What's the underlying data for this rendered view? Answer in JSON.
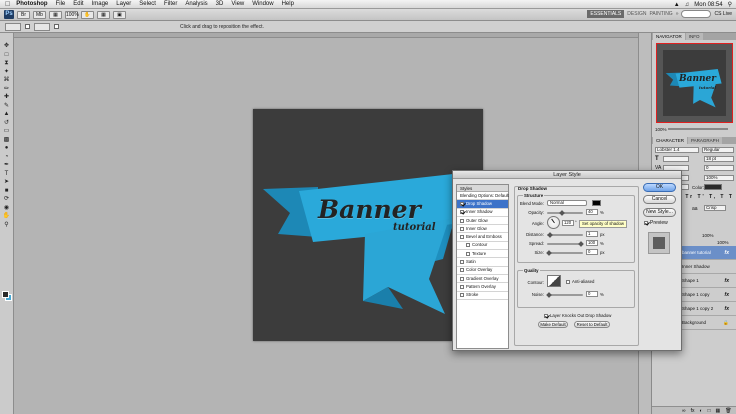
{
  "menubar": {
    "app": "Photoshop",
    "items": [
      "File",
      "Edit",
      "Image",
      "Layer",
      "Select",
      "Filter",
      "Analysis",
      "3D",
      "View",
      "Window",
      "Help"
    ],
    "clock": "Mon 08:54"
  },
  "appbar": {
    "zoom": "100%",
    "workspaces": [
      "ESSENTIALS",
      "DESIGN",
      "PAINTING"
    ],
    "cs_live": "CS Live"
  },
  "options": {
    "hint": "Click and drag to reposition the effect."
  },
  "canvas": {
    "title": "Banner",
    "subtitle": "tutorial",
    "ribbon_color": "#29a8d8"
  },
  "navigator": {
    "tabs": [
      "NAVIGATOR",
      "INFO"
    ],
    "zoom": "100%",
    "title": "Banner",
    "subtitle": "tutorial"
  },
  "character": {
    "tabs": [
      "CHARACTER",
      "PARAGRAPH"
    ],
    "font": "Lobster 1.4",
    "style": "Regular",
    "size": "18 pt",
    "leading": "0",
    "scale": "100%",
    "color_label": "Color:",
    "aa": "Crisp"
  },
  "layers": {
    "rows": [
      {
        "name": "banner tutorial",
        "fx": "fx",
        "selected": true
      },
      {
        "name": "Inner Shadow",
        "fx": "",
        "selected": false
      },
      {
        "name": "Shape 1",
        "fx": "fx",
        "selected": false
      },
      {
        "name": "Shape 1 copy",
        "fx": "fx",
        "selected": false
      },
      {
        "name": "Shape 1 copy 2",
        "fx": "fx",
        "selected": false
      },
      {
        "name": "Background",
        "fx": "",
        "selected": false
      }
    ],
    "opacity": "100%",
    "fill": "100%"
  },
  "dialog": {
    "title": "Layer Style",
    "styles_header": "Styles",
    "styles": [
      {
        "label": "Blending Options: Default",
        "check": false,
        "hasbox": false,
        "indent": false,
        "selected": false
      },
      {
        "label": "Drop Shadow",
        "check": true,
        "hasbox": true,
        "indent": false,
        "selected": true
      },
      {
        "label": "Inner Shadow",
        "check": true,
        "hasbox": true,
        "indent": false,
        "selected": false
      },
      {
        "label": "Outer Glow",
        "check": false,
        "hasbox": true,
        "indent": false,
        "selected": false
      },
      {
        "label": "Inner Glow",
        "check": false,
        "hasbox": true,
        "indent": false,
        "selected": false
      },
      {
        "label": "Bevel and Emboss",
        "check": false,
        "hasbox": true,
        "indent": false,
        "selected": false
      },
      {
        "label": "Contour",
        "check": false,
        "hasbox": true,
        "indent": true,
        "selected": false
      },
      {
        "label": "Texture",
        "check": false,
        "hasbox": true,
        "indent": true,
        "selected": false
      },
      {
        "label": "Satin",
        "check": false,
        "hasbox": true,
        "indent": false,
        "selected": false
      },
      {
        "label": "Color Overlay",
        "check": false,
        "hasbox": true,
        "indent": false,
        "selected": false
      },
      {
        "label": "Gradient Overlay",
        "check": false,
        "hasbox": true,
        "indent": false,
        "selected": false
      },
      {
        "label": "Pattern Overlay",
        "check": false,
        "hasbox": true,
        "indent": false,
        "selected": false
      },
      {
        "label": "Stroke",
        "check": false,
        "hasbox": true,
        "indent": false,
        "selected": false
      }
    ],
    "section_title": "Drop Shadow",
    "structure_label": "Structure",
    "blend_mode_label": "Blend Mode:",
    "blend_mode": "Normal",
    "opacity_label": "Opacity:",
    "opacity": "40",
    "opacity_value": 40,
    "angle_label": "Angle:",
    "angle": "120",
    "tooltip": "Set opacity of shadow",
    "distance_label": "Distance:",
    "distance": "1",
    "distance_value": 1,
    "spread_label": "Spread:",
    "spread": "100",
    "spread_value": 100,
    "size_label": "Size:",
    "size": "0",
    "size_value": 0,
    "quality_label": "Quality",
    "contour_label": "Contour:",
    "anti_aliased_label": "Anti-aliased",
    "noise_label": "Noise:",
    "noise": "0",
    "noise_value": 0,
    "knockout_label": "Layer Knocks Out Drop Shadow",
    "make_default": "Make Default",
    "reset_default": "Reset to Default",
    "unit_px": "px",
    "unit_pct": "%",
    "unit_deg": "°",
    "ok": "OK",
    "cancel": "Cancel",
    "new_style": "New Style...",
    "preview": "Preview"
  }
}
